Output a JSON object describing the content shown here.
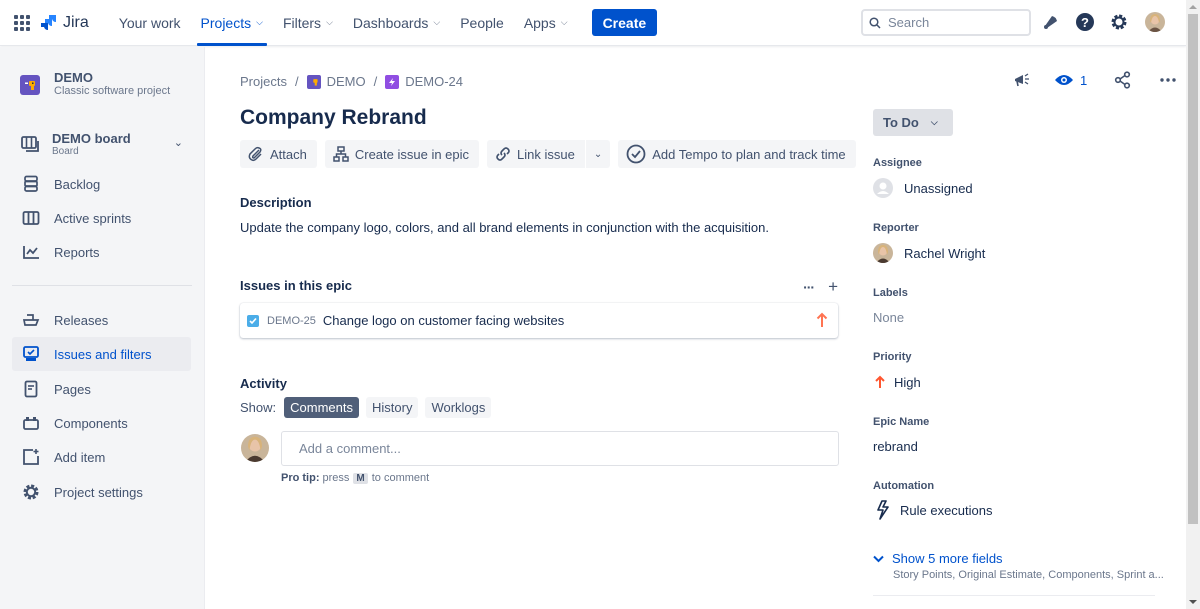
{
  "topnav": {
    "logo": "Jira",
    "items": [
      {
        "label": "Your work",
        "dropdown": false,
        "active": false
      },
      {
        "label": "Projects",
        "dropdown": true,
        "active": true
      },
      {
        "label": "Filters",
        "dropdown": true,
        "active": false
      },
      {
        "label": "Dashboards",
        "dropdown": true,
        "active": false
      },
      {
        "label": "People",
        "dropdown": false,
        "active": false
      },
      {
        "label": "Apps",
        "dropdown": true,
        "active": false
      }
    ],
    "create_label": "Create",
    "search_placeholder": "Search",
    "icons": [
      "notifications-icon",
      "help-icon",
      "settings-icon",
      "profile-avatar"
    ]
  },
  "sidebar": {
    "project_name": "DEMO",
    "project_type": "Classic software project",
    "board_name": "DEMO board",
    "board_sub": "Board",
    "items": [
      {
        "label": "Backlog",
        "icon": "backlog-icon"
      },
      {
        "label": "Active sprints",
        "icon": "active-sprints-icon"
      },
      {
        "label": "Reports",
        "icon": "reports-icon"
      },
      {
        "label": "Releases",
        "icon": "releases-icon"
      },
      {
        "label": "Issues and filters",
        "icon": "issues-filters-icon",
        "active": true
      },
      {
        "label": "Pages",
        "icon": "pages-icon"
      },
      {
        "label": "Components",
        "icon": "components-icon"
      },
      {
        "label": "Add item",
        "icon": "add-item-icon"
      },
      {
        "label": "Project settings",
        "icon": "project-settings-icon"
      }
    ]
  },
  "issue": {
    "breadcrumb": [
      "Projects",
      "DEMO",
      "DEMO-24"
    ],
    "title": "Company Rebrand",
    "actions": {
      "attach": "Attach",
      "create_in_epic": "Create issue in epic",
      "link_issue": "Link issue",
      "tempo": "Add Tempo to plan and track time"
    },
    "description_label": "Description",
    "description": "Update the company logo, colors, and all brand elements in conjunction with the acquisition.",
    "epic_label": "Issues in this epic",
    "epic_issues": [
      {
        "key": "DEMO-25",
        "summary": "Change logo on customer facing websites",
        "type": "task",
        "priority": "high"
      }
    ],
    "activity_label": "Activity",
    "show_label": "Show:",
    "activity_tabs": [
      {
        "label": "Comments",
        "selected": true
      },
      {
        "label": "History",
        "selected": false
      },
      {
        "label": "Worklogs",
        "selected": false
      }
    ],
    "comment_placeholder": "Add a comment...",
    "protip_bold": "Pro tip:",
    "protip_press": "press",
    "protip_key": "M",
    "protip_rest": "to comment"
  },
  "details": {
    "watchers": "1",
    "status": "To Do",
    "assignee_label": "Assignee",
    "assignee": "Unassigned",
    "reporter_label": "Reporter",
    "reporter": "Rachel Wright",
    "labels_label": "Labels",
    "labels": "None",
    "priority_label": "Priority",
    "priority": "High",
    "epic_name_label": "Epic Name",
    "epic_name": "rebrand",
    "automation_label": "Automation",
    "automation": "Rule executions",
    "more_fields": "Show 5 more fields",
    "more_fields_sub": "Story Points, Original Estimate, Components, Sprint a..."
  },
  "colors": {
    "brand": "#0052cc",
    "project_icon": "#6554c0",
    "epic_icon": "#904ee2",
    "priority_high": "#ff5630",
    "priority_epic_child": "#ff7452",
    "task_checkbox": "#4bade8"
  }
}
